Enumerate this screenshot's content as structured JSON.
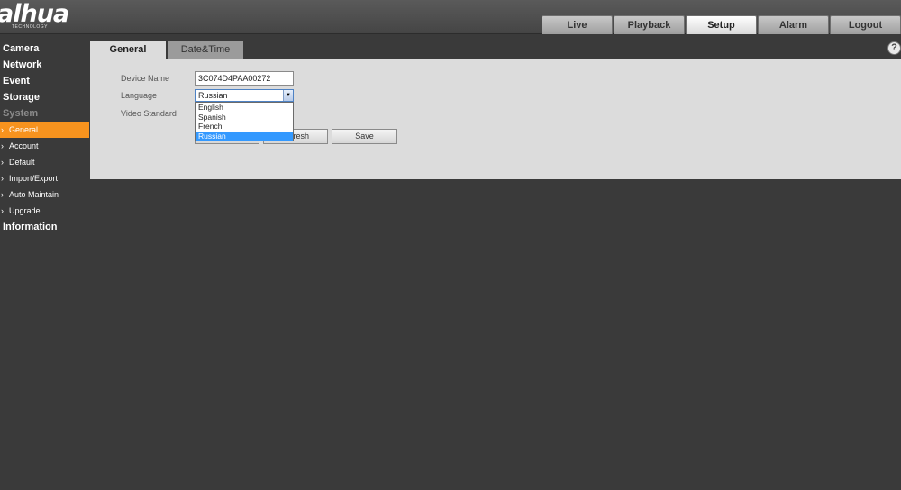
{
  "brand": {
    "logo_text": "alhua",
    "logo_subtext": "TECHNOLOGY"
  },
  "nav": [
    {
      "label": "Live",
      "active": false
    },
    {
      "label": "Playback",
      "active": false
    },
    {
      "label": "Setup",
      "active": true
    },
    {
      "label": "Alarm",
      "active": false
    },
    {
      "label": "Logout",
      "active": false
    }
  ],
  "sidebar": {
    "camera": "Camera",
    "network": "Network",
    "event": "Event",
    "storage": "Storage",
    "system": "System",
    "system_items": [
      "General",
      "Account",
      "Default",
      "Import/Export",
      "Auto Maintain",
      "Upgrade"
    ],
    "information": "Information"
  },
  "tabs": {
    "general": "General",
    "datetime": "Date&Time"
  },
  "help_icon": "?",
  "form": {
    "device_name_label": "Device Name",
    "device_name_value": "3C074D4PAA00272",
    "language_label": "Language",
    "language_value": "Russian",
    "video_standard_label": "Video Standard",
    "language_options": [
      "English",
      "Spanish",
      "French",
      "Russian"
    ]
  },
  "buttons": {
    "refresh_visible": "resh",
    "save": "Save"
  },
  "colors": {
    "accent": "#f7931e",
    "selected_option": "#3399ff",
    "background": "#3a3a3a",
    "panel": "#dcdcdc"
  }
}
